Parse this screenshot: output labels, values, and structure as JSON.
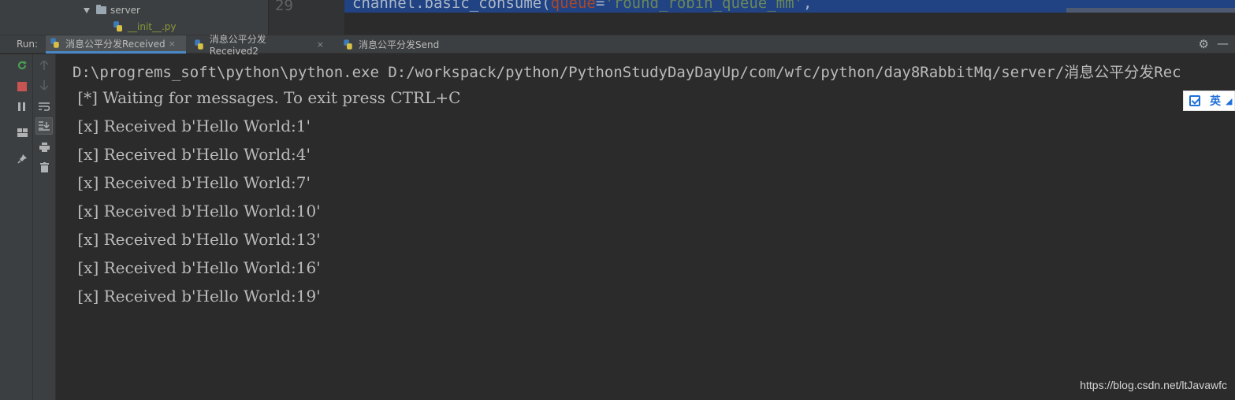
{
  "project_tree": {
    "folder": "server",
    "file": "__init__.py"
  },
  "editor": {
    "line_number": "29",
    "code_prefix": "channel.basic_consume(",
    "code_keyword": "queue",
    "code_eq": "=",
    "code_string": "'round_robin_queue_mm'",
    "code_suffix": ","
  },
  "run_bar": {
    "label": "Run:",
    "tabs": [
      {
        "label": "消息公平分发Received",
        "active": true
      },
      {
        "label": "消息公平分发Received2",
        "active": false
      },
      {
        "label": "消息公平分发Send",
        "active": false
      }
    ],
    "close_glyph": "×"
  },
  "icons": {
    "rerun": "rerun-icon",
    "stop": "stop-icon",
    "pause": "pause-icon",
    "layout": "layout-icon",
    "pin": "pin-icon",
    "up": "arrow-up-icon",
    "down": "arrow-down-icon",
    "soft_wrap": "soft-wrap-icon",
    "scroll_end": "scroll-to-end-icon",
    "print": "print-icon",
    "trash": "trash-icon",
    "gear": "gear-icon",
    "minimize": "minimize-icon"
  },
  "console": {
    "command": "D:\\progrems_soft\\python\\python.exe D:/workspack/python/PythonStudyDayDayUp/com/wfc/python/day8RabbitMq/server/消息公平分发Rec",
    "lines": [
      " [*] Waiting for messages. To exit press CTRL+C",
      " [x] Received b'Hello World:1'",
      " [x] Received b'Hello World:4'",
      " [x] Received b'Hello World:7'",
      " [x] Received b'Hello World:10'",
      " [x] Received b'Hello World:13'",
      " [x] Received b'Hello World:16'",
      " [x] Received b'Hello World:19'"
    ]
  },
  "ime_toolbar": {
    "label": "英"
  },
  "watermark": "https://blog.csdn.net/ltJavawfc",
  "colors": {
    "background": "#2b2b2b",
    "panel": "#3c3f41",
    "text": "#bbbbbb",
    "rerun": "#499c54",
    "stop": "#c75450",
    "tab_underline": "#4a88c7"
  }
}
